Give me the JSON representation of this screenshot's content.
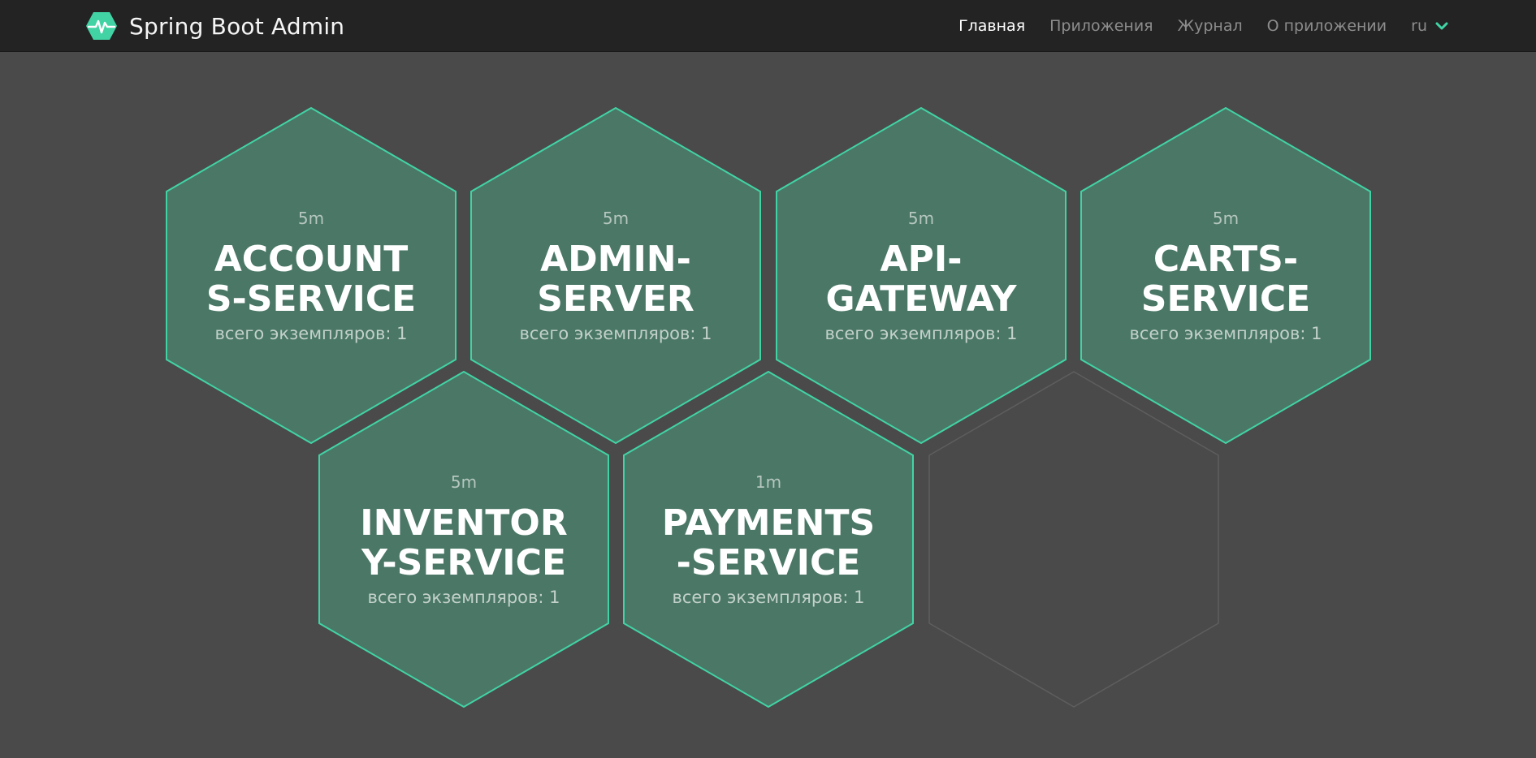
{
  "header": {
    "title": "Spring Boot Admin",
    "nav": [
      {
        "label": "Главная",
        "active": true
      },
      {
        "label": "Приложения",
        "active": false
      },
      {
        "label": "Журнал",
        "active": false
      },
      {
        "label": "О приложении",
        "active": false
      }
    ],
    "language": "ru"
  },
  "colors": {
    "accent": "#42d3a5",
    "hex_fill": "#4a7766",
    "hex_border": "#42d3a5",
    "empty_hex_border": "#5e5e5e",
    "background": "#4a4a4a",
    "navbar": "#232323"
  },
  "applications": [
    {
      "name": "ACCOUNTS-SERVICE",
      "time": "5m",
      "instances": "всего экземпляров: 1"
    },
    {
      "name": "ADMIN-SERVER",
      "time": "5m",
      "instances": "всего экземпляров: 1"
    },
    {
      "name": "API-GATEWAY",
      "time": "5m",
      "instances": "всего экземпляров: 1"
    },
    {
      "name": "CARTS-SERVICE",
      "time": "5m",
      "instances": "всего экземпляров: 1"
    },
    {
      "name": "INVENTORY-SERVICE",
      "time": "5m",
      "instances": "всего экземпляров: 1"
    },
    {
      "name": "PAYMENTS-SERVICE",
      "time": "1m",
      "instances": "всего экземпляров: 1"
    }
  ]
}
